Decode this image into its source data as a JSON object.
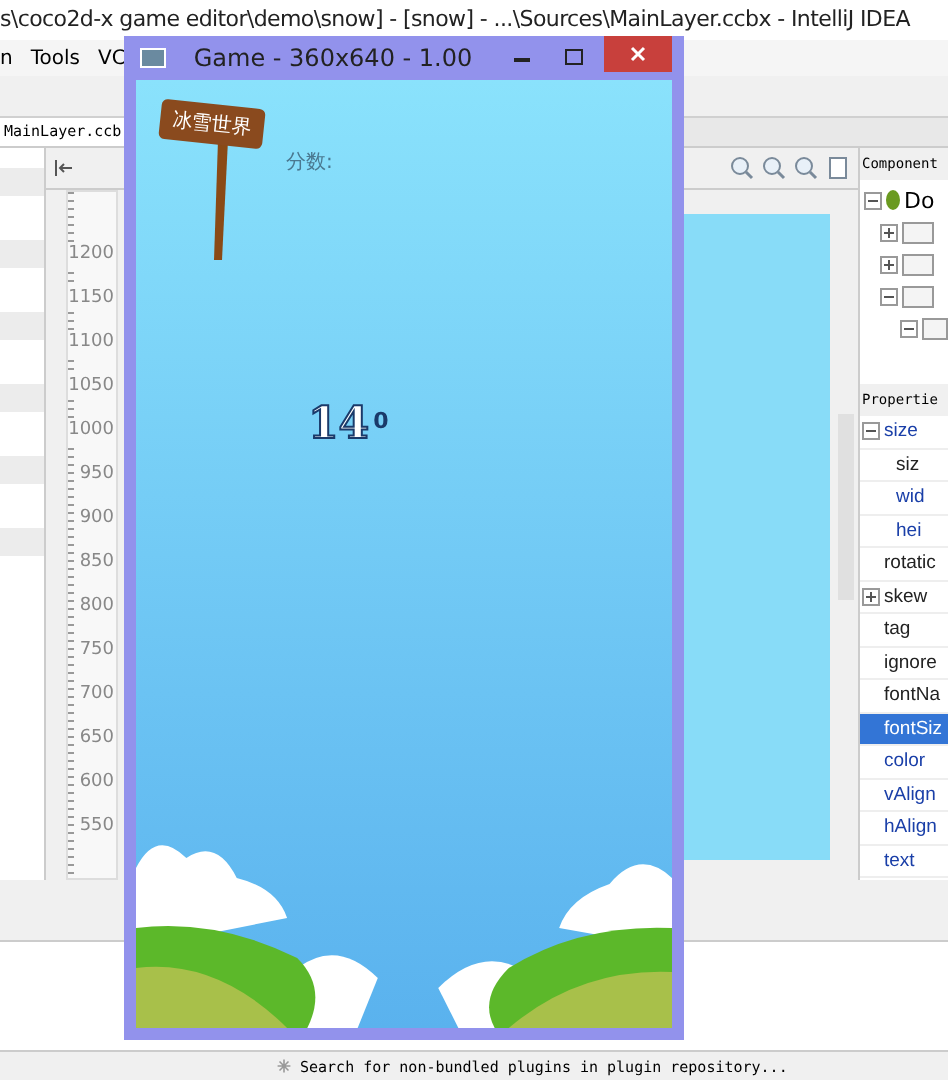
{
  "ide": {
    "title": "s\\coco2d-x game editor\\demo\\snow] - [snow] - ...\\Sources\\MainLayer.ccbx - IntelliJ IDEA",
    "menu": [
      "n",
      "Tools",
      "VC"
    ],
    "file_tab": "MainLayer.ccb",
    "ruler_labels": [
      "1200",
      "1150",
      "1100",
      "1050",
      "1000",
      "950",
      "900",
      "850",
      "800",
      "750",
      "700",
      "650",
      "600",
      "550"
    ],
    "component_tree": {
      "header": "Component",
      "root": {
        "label": "Do",
        "expanded": true,
        "children": [
          {
            "expanded": false
          },
          {
            "expanded": false
          },
          {
            "expanded": true,
            "children": [
              {
                "expanded": true
              }
            ]
          }
        ]
      }
    },
    "properties": {
      "header": "Propertie",
      "rows": [
        {
          "label": "size",
          "kind": "group",
          "expanded": true,
          "modified": true,
          "selected": false
        },
        {
          "label": "siz",
          "kind": "child",
          "modified": false,
          "selected": false
        },
        {
          "label": "wid",
          "kind": "child",
          "modified": true,
          "selected": false
        },
        {
          "label": "hei",
          "kind": "child",
          "modified": true,
          "selected": false
        },
        {
          "label": "rotatic",
          "kind": "plain",
          "modified": false,
          "selected": false
        },
        {
          "label": "skew",
          "kind": "group",
          "expanded": false,
          "modified": false,
          "selected": false
        },
        {
          "label": "tag",
          "kind": "plain",
          "modified": false,
          "selected": false
        },
        {
          "label": "ignore",
          "kind": "plain",
          "modified": false,
          "selected": false
        },
        {
          "label": "fontNa",
          "kind": "plain",
          "modified": false,
          "selected": false
        },
        {
          "label": "fontSiz",
          "kind": "plain",
          "modified": true,
          "selected": true
        },
        {
          "label": "color",
          "kind": "plain",
          "modified": true,
          "selected": false
        },
        {
          "label": "vAlign",
          "kind": "plain",
          "modified": true,
          "selected": false
        },
        {
          "label": "hAlign",
          "kind": "plain",
          "modified": true,
          "selected": false
        },
        {
          "label": "text",
          "kind": "plain",
          "modified": true,
          "selected": false
        }
      ]
    },
    "status_bar": "Search for non-bundled plugins in plugin repository..."
  },
  "game_window": {
    "title": "Game - 360x640 - 1.00",
    "sign_text": "冰雪世界",
    "score_label": "分数:",
    "score": "14",
    "score_suffix": "0"
  }
}
